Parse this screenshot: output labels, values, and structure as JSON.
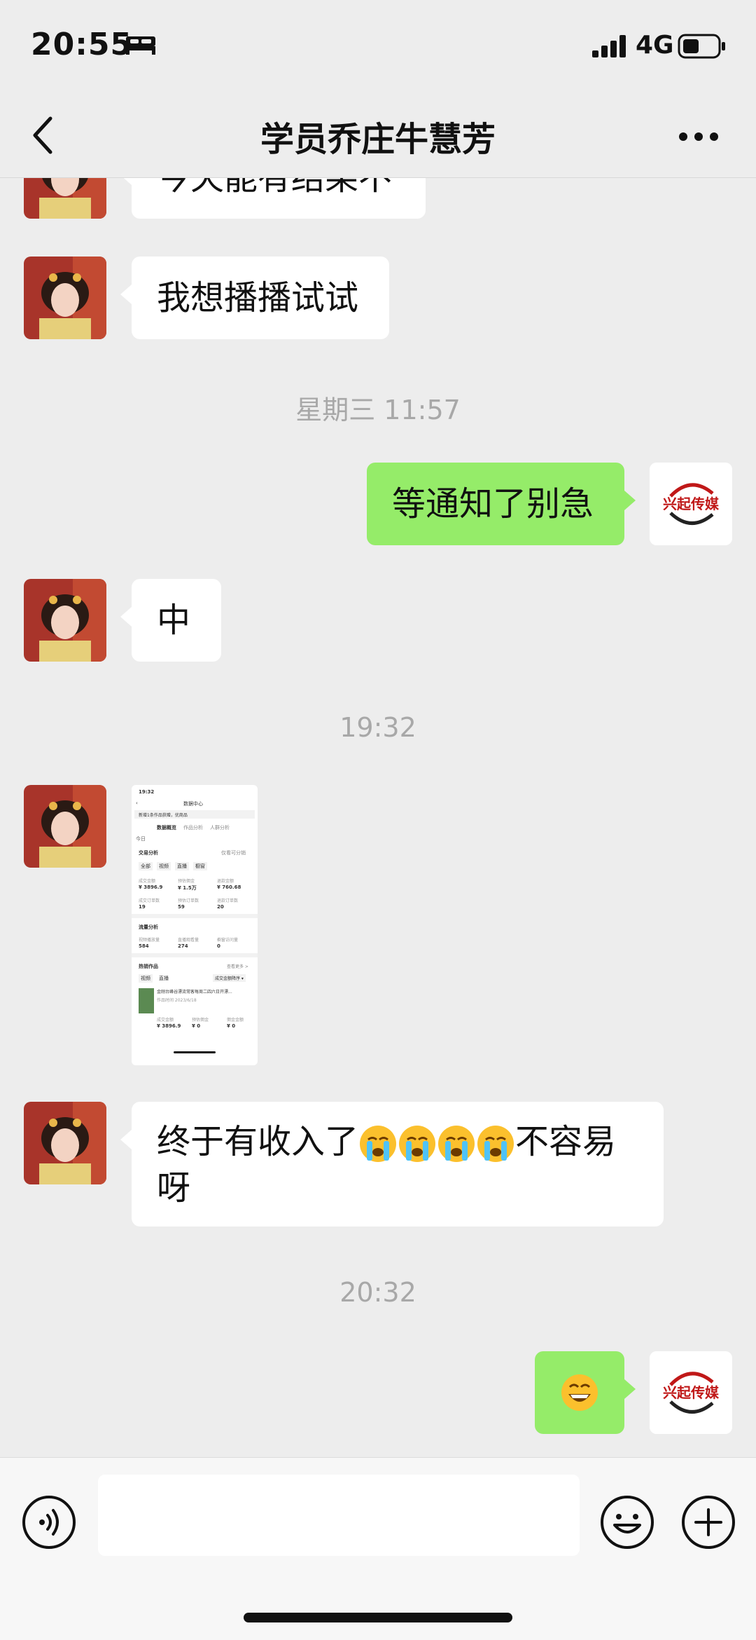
{
  "status_bar": {
    "time": "20:55",
    "network": "4G"
  },
  "nav": {
    "title": "学员乔庄牛慧芳"
  },
  "chat": {
    "msg_partial": "今天能有结果不",
    "msg_try": "我想播播试试",
    "ts_1": "星期三 11:57",
    "msg_wait": "等通知了别急",
    "msg_ok": "中",
    "ts_2": "19:32",
    "msg_income_pre": "终于有收入了",
    "msg_income_post": "不容易",
    "msg_income_tail": "呀",
    "ts_3": "20:32"
  },
  "thumbnail": {
    "time": "19:32",
    "title": "数据中心",
    "notice": "新增1条作品获赠，优商品",
    "tabs": [
      "数据概览",
      "作品分析",
      "人群分析"
    ],
    "today": "今日",
    "trade_title": "交易分析",
    "checkbox": "仅看可分销",
    "chips": [
      "全部",
      "视频",
      "直播",
      "橱窗"
    ],
    "trade_labels": [
      "成交金额",
      "预估佣金",
      "退款金额"
    ],
    "trade_values": [
      "¥ 3896.9",
      "¥ 1.5万",
      "¥ 760.68"
    ],
    "order_labels": [
      "成交订单数",
      "预估订单数",
      "退款订单数"
    ],
    "order_values": [
      "19",
      "59",
      "20"
    ],
    "flow_title": "流量分析",
    "flow_labels": [
      "视频播放量",
      "直播观看量",
      "橱窗访问量"
    ],
    "flow_values": [
      "584",
      "274",
      "0"
    ],
    "hot_title": "热销作品",
    "more": "查看更多 >",
    "hot_tabs": [
      "视频",
      "直播"
    ],
    "sort": "成交金额降序 ▾",
    "item_title": "金刚台峰谷漂流常客每周二四六日开漂...",
    "item_date": "作品时间 2023/6/18",
    "item_labels": [
      "成交金额",
      "预估佣金",
      "佣金金额"
    ],
    "item_values": [
      "¥ 3896.9",
      "¥ 0",
      "¥ 0"
    ]
  },
  "avatar_self": {
    "logo_text": "兴起传媒"
  },
  "colors": {
    "background": "#ededed",
    "outgoing_bubble": "#95ec69",
    "incoming_bubble": "#ffffff"
  }
}
